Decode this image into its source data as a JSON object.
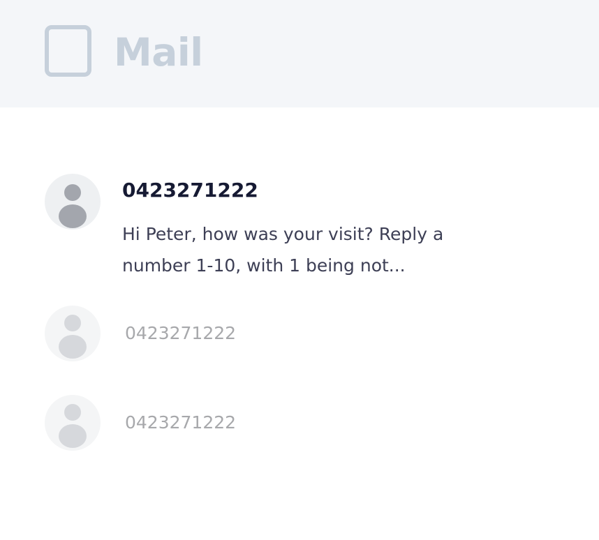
{
  "app": {
    "title": "Mail",
    "icon": "app-square-icon",
    "colors": {
      "header_bg": "#f4f6f9",
      "header_fg": "#c6d0db",
      "sender_active": "#161a33",
      "preview_text": "#3d3f55",
      "sender_dim": "#a7a8ab"
    }
  },
  "threads": [
    {
      "sender": "0423271222",
      "preview": "Hi Peter, how was your visit? Reply a number 1-10, with 1 being not...",
      "avatar_icon": "person-icon",
      "active": true
    },
    {
      "sender": "0423271222",
      "avatar_icon": "person-icon",
      "active": false
    },
    {
      "sender": "0423271222",
      "avatar_icon": "person-icon",
      "active": false
    }
  ]
}
